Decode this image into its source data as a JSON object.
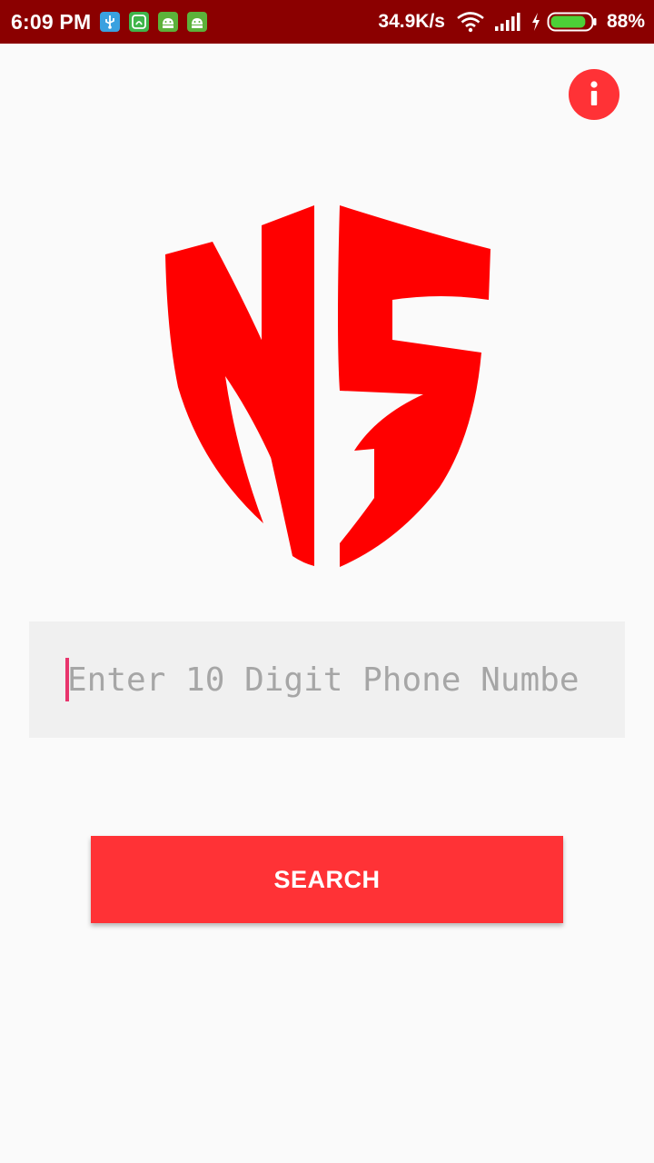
{
  "status_bar": {
    "time": "6:09 PM",
    "network_speed": "34.9K/s",
    "battery_percent": "88%",
    "battery_level": 0.88,
    "notification_icons": [
      "usb-icon",
      "saavn-icon",
      "android-icon",
      "android-icon"
    ],
    "background_color": "#8b0000"
  },
  "info_button": {
    "icon": "info-icon",
    "color": "#ff3236"
  },
  "logo": {
    "text": "NS",
    "color": "#ff0000"
  },
  "phone_input": {
    "placeholder": "Enter 10 Digit Phone Numbe",
    "value": ""
  },
  "search_button": {
    "label": "SEARCH",
    "color": "#ff3236"
  }
}
